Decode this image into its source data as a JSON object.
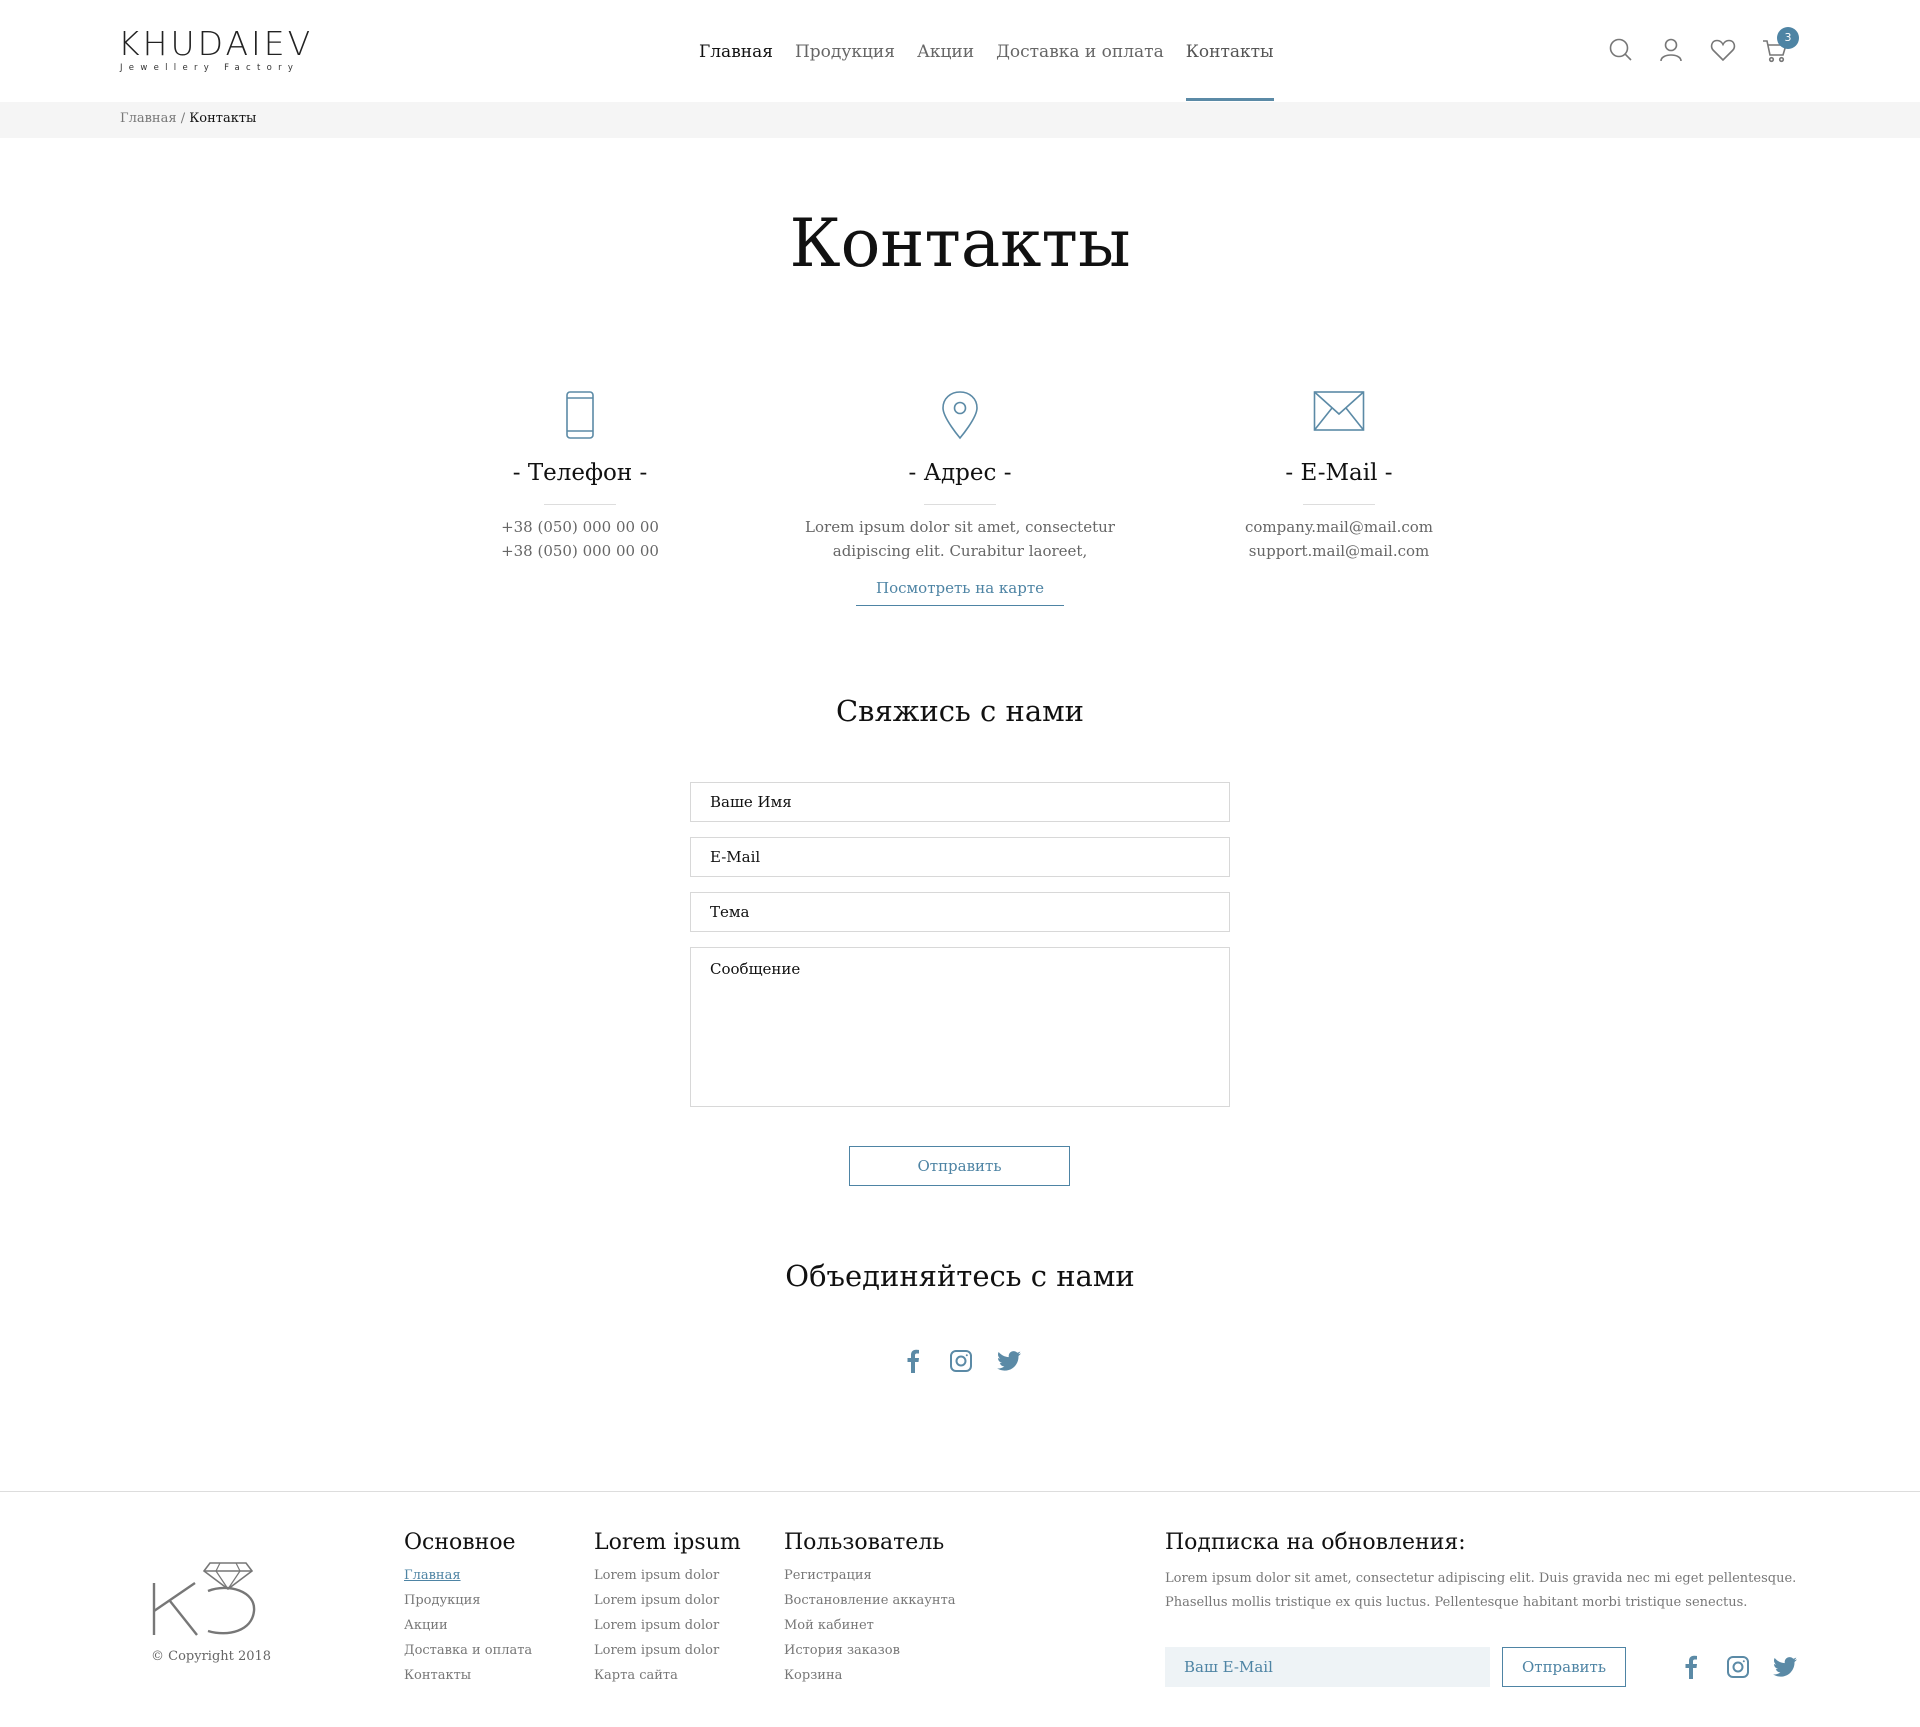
{
  "brand": {
    "name": "KHUDAIEV",
    "subtitle": "Jewellery Factory"
  },
  "nav": {
    "items": [
      {
        "label": "Главная"
      },
      {
        "label": "Продукция"
      },
      {
        "label": "Акции"
      },
      {
        "label": "Доставка и оплата"
      },
      {
        "label": "Контакты"
      }
    ],
    "active": "Контакты"
  },
  "header_icons": [
    "search-icon",
    "user-icon",
    "heart-icon",
    "cart-icon"
  ],
  "cart_count": "3",
  "breadcrumb": {
    "home": "Главная",
    "separator": "/",
    "current": "Контакты"
  },
  "page_title": "Контакты",
  "contacts": {
    "phone": {
      "icon": "phone-icon",
      "heading": "- Телефон -",
      "lines": [
        "+38 (050) 000 00 00",
        "+38 (050) 000 00 00"
      ]
    },
    "address": {
      "icon": "location-pin-icon",
      "heading": "- Адрес -",
      "lines": [
        "Lorem ipsum dolor sit amet, consectetur",
        "adipiscing elit. Curabitur laoreet,"
      ],
      "map_link": "Посмотреть на карте"
    },
    "email": {
      "icon": "envelope-icon",
      "heading": "- E-Mail -",
      "lines": [
        "company.mail@mail.com",
        "support.mail@mail.com"
      ]
    }
  },
  "form": {
    "title": "Свяжись с нами",
    "name_placeholder": "Ваше Имя",
    "email_placeholder": "E-Mail",
    "subject_placeholder": "Тема",
    "message_placeholder": "Сообщение",
    "submit_label": "Отправить"
  },
  "social_section": {
    "title": "Объединяйтесь с нами",
    "icons": [
      "facebook-icon",
      "instagram-icon",
      "twitter-icon"
    ]
  },
  "footer": {
    "copyright": "© Copyright 2018",
    "columns": [
      {
        "title": "Основное",
        "links": [
          "Главная",
          "Продукция",
          "Акции",
          "Доставка и оплата",
          "Контакты"
        ]
      },
      {
        "title": "Lorem ipsum",
        "links": [
          "Lorem ipsum dolor",
          "Lorem ipsum dolor",
          "Lorem ipsum dolor",
          "Lorem ipsum dolor",
          "Карта сайта"
        ]
      },
      {
        "title": "Пользователь",
        "links": [
          "Регистрация",
          "Востановление аккаунта",
          "Мой кабинет",
          "История заказов",
          "Корзина"
        ]
      }
    ],
    "subscribe": {
      "title": "Подписка на обновления:",
      "text": "Lorem ipsum dolor sit amet, consectetur adipiscing elit. Duis gravida nec mi eget pellentesque. Phasellus mollis tristique ex quis luctus. Pellentesque habitant morbi tristique senectus.",
      "placeholder": "Ваш E-Mail",
      "button": "Отправить"
    }
  },
  "colors": {
    "accent": "#4e84a4",
    "breadcrumb_bg": "#f5f5f5",
    "subscribe_input_bg": "#eef3f6"
  }
}
